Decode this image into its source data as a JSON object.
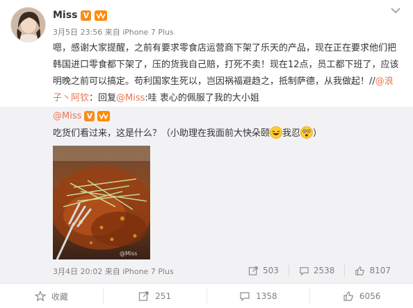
{
  "post": {
    "user_name": "Miss",
    "verified_badge": "V",
    "timestamp": "3月5日 23:56",
    "source": "来自 iPhone 7 Plus",
    "content_prefix": "嗯，感谢大家提醒，之前有要求零食店运营商下架了乐天的产品，现在正在要求他们把韩国进口零食都下架了，压的货我自己赔，打死不卖！现在12点，员工都下班了，应该明晚之前可以搞定。苟利国家生死以，岂因祸福避趋之，抵制萨德，从我做起！//",
    "mention_1": "@浪子丶阿钦",
    "content_mid": "：回复",
    "mention_2": "@Miss",
    "content_suffix": ":哇 衷心的佩服了我的大小姐"
  },
  "repost": {
    "user_name": "@Miss",
    "verified_badge": "V",
    "text_prefix": "吃货们看过来，这是什么？（小助理在我面前大快朵颐",
    "text_mid": "我忍",
    "text_suffix": "）",
    "photo_watermark": "@Miss",
    "timestamp": "3月4日 20:02",
    "source": "来自 iPhone 7 Plus",
    "stats": {
      "reposts": "503",
      "comments": "2538",
      "likes": "8107"
    }
  },
  "actions": {
    "favorite": "收藏",
    "repost": "251",
    "comment": "1358",
    "like": "6056"
  },
  "colors": {
    "mention": "#eb7350",
    "meta_gray": "#808080",
    "repost_bg": "#f2f2f5",
    "verified": "#f78c1f"
  }
}
